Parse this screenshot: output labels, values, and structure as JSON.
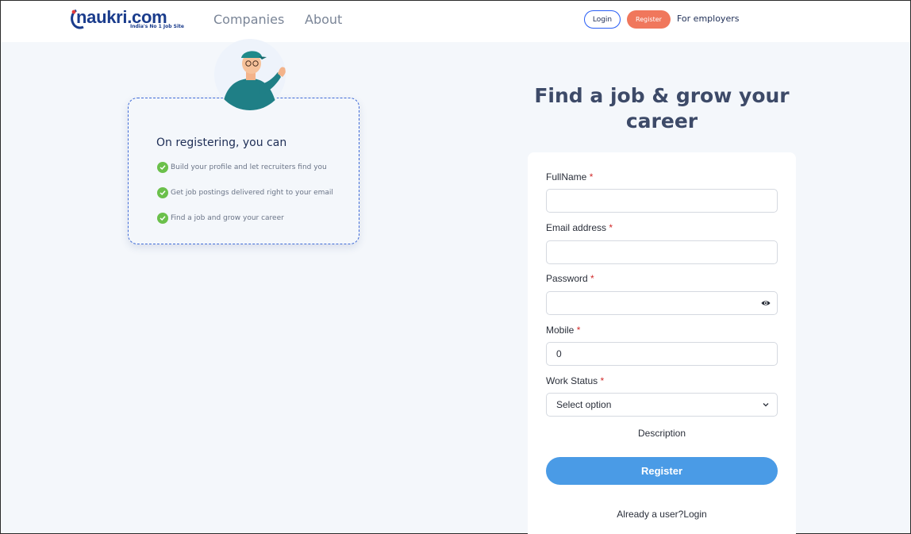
{
  "header": {
    "logo_text": "naukri.com",
    "logo_tagline": "India's No 1 Job Site",
    "nav": [
      "Companies",
      "About"
    ],
    "login_label": "Login",
    "register_label": "Register",
    "employers_label": "For employers"
  },
  "benefits": {
    "title": "On registering, you can",
    "items": [
      "Build your profile and let recruiters find you",
      "Get job postings delivered right to your email",
      "Find a job and grow your career"
    ]
  },
  "form": {
    "heading": "Find a job & grow your career",
    "fields": {
      "fullname": {
        "label": "FullName",
        "value": ""
      },
      "email": {
        "label": "Email address",
        "value": ""
      },
      "password": {
        "label": "Password",
        "value": ""
      },
      "mobile": {
        "label": "Mobile",
        "value": "0"
      },
      "work_status": {
        "label": "Work Status",
        "selected": "Select option"
      }
    },
    "required_mark": "*",
    "description": "Description",
    "submit_label": "Register",
    "already_user": "Already a user?Login"
  },
  "colors": {
    "brand_blue": "#275df5",
    "register_orange": "#f0775c",
    "submit_blue": "#4a9be6",
    "page_bg": "#f4f7fb",
    "check_green": "#6bc04b"
  }
}
